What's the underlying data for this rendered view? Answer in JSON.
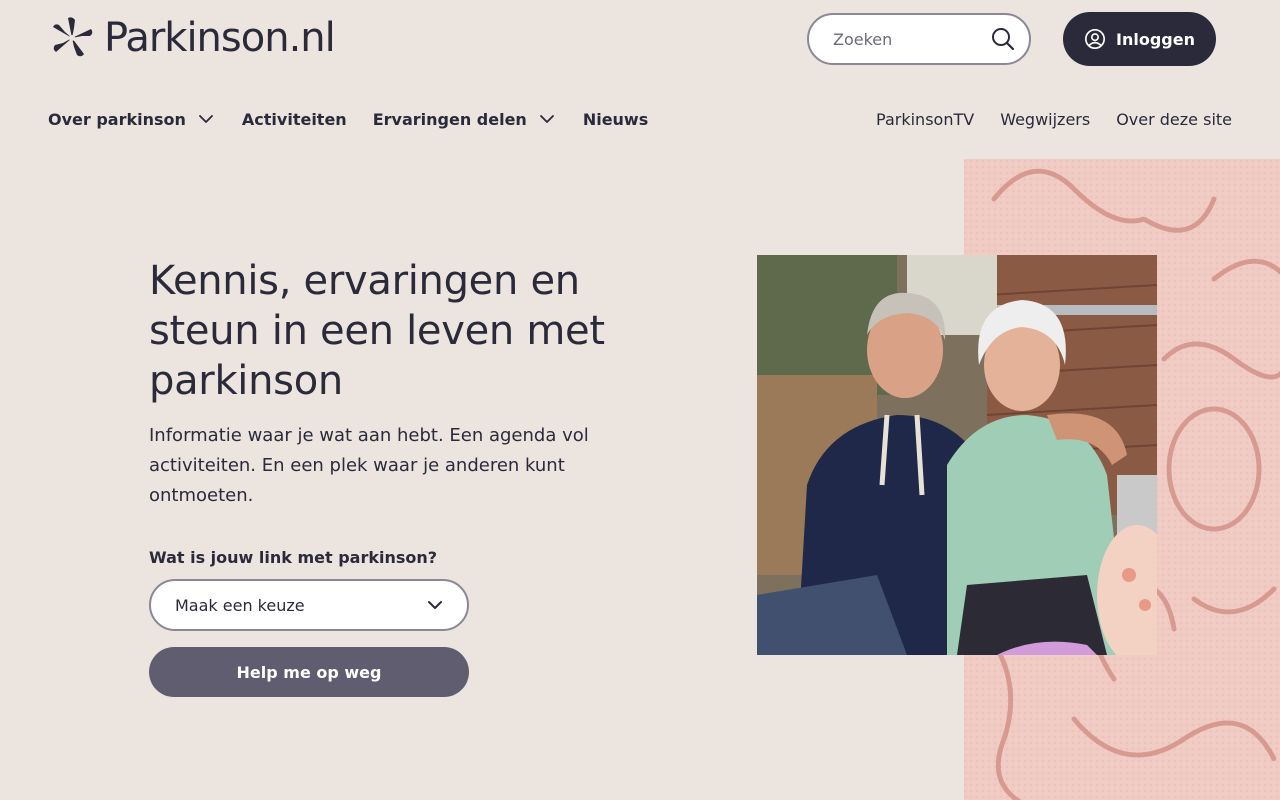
{
  "brand": {
    "name": "Parkinson.nl",
    "logo_icon": "parkinson-star-logo"
  },
  "colors": {
    "background": "#ebe4df",
    "primary_dark": "#2b2a3b",
    "button_muted": "#605d70",
    "accent_pink": "#f0cbc4"
  },
  "search": {
    "placeholder": "Zoeken",
    "icon": "search-icon"
  },
  "login": {
    "label": "Inloggen",
    "icon": "user-circle-icon"
  },
  "nav_main": [
    {
      "label": "Over parkinson",
      "has_dropdown": true
    },
    {
      "label": "Activiteiten",
      "has_dropdown": false
    },
    {
      "label": "Ervaringen delen",
      "has_dropdown": true
    },
    {
      "label": "Nieuws",
      "has_dropdown": false
    }
  ],
  "nav_secondary": [
    {
      "label": "ParkinsonTV"
    },
    {
      "label": "Wegwijzers"
    },
    {
      "label": "Over deze site"
    }
  ],
  "hero": {
    "title": "Kennis, ervaringen en steun in een leven met parkinson",
    "subtitle": "Informatie waar je wat aan hebt. Een agenda vol activiteiten. En een plek waar je anderen kunt ontmoeten.",
    "select_label": "Wat is jouw link met parkinson?",
    "select_value": "Maak een keuze",
    "cta_label": "Help me op weg"
  }
}
